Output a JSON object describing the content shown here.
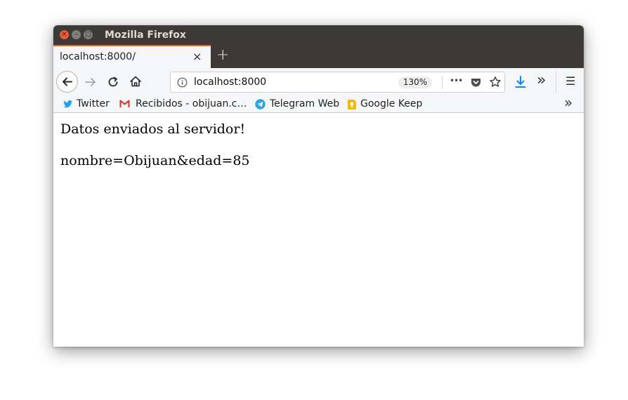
{
  "window": {
    "title": "Mozilla Firefox",
    "controls": {
      "close": "×",
      "minimize": "–",
      "maximize": "□"
    }
  },
  "tabs": [
    {
      "title": "localhost:8000/",
      "active": true
    }
  ],
  "tabstrip": {
    "new_tab_symbol": "+",
    "close_symbol": "×"
  },
  "navbar": {
    "url": "localhost:8000",
    "zoom": "130%",
    "overflow_symbol": "•••",
    "more_tools_symbol": "»",
    "menu_symbol": "☰"
  },
  "bookmarks": {
    "items": [
      {
        "label": "Twitter",
        "icon": "twitter-icon"
      },
      {
        "label": "Recibidos - obijuan.c…",
        "icon": "gmail-icon"
      },
      {
        "label": "Telegram Web",
        "icon": "telegram-icon"
      },
      {
        "label": "Google Keep",
        "icon": "google-keep-icon"
      }
    ],
    "overflow_symbol": "»"
  },
  "page": {
    "heading": "Datos enviados al servidor!",
    "data_line": "nombre=Obijuan&edad=85"
  },
  "colors": {
    "titlebar": "#3b3a36",
    "tab_accent": "#e86535",
    "toolbar": "#f5f6f7",
    "download_blue": "#0a84ff",
    "twitter_blue": "#1da1f2",
    "telegram_blue": "#2ca5e0",
    "keep_yellow": "#f6b70b",
    "gmail_red": "#d93025"
  }
}
